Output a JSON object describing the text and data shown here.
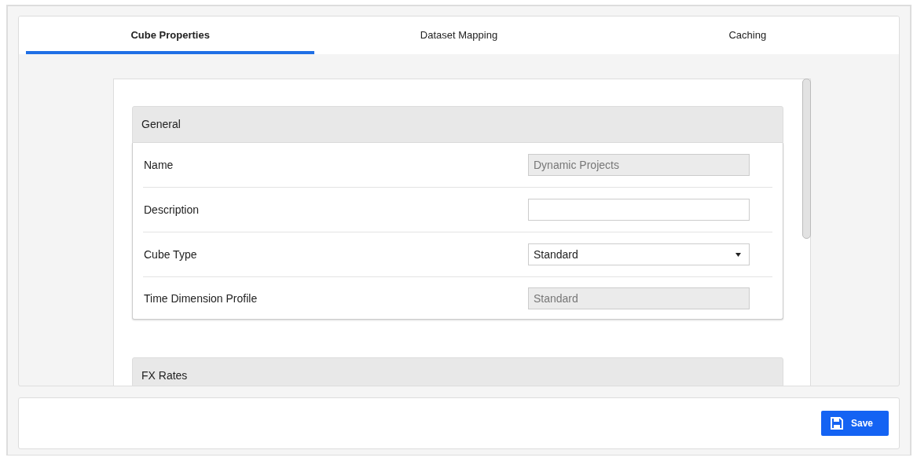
{
  "tabs": [
    {
      "label": "Cube Properties",
      "selected": true
    },
    {
      "label": "Dataset Mapping",
      "selected": false
    },
    {
      "label": "Caching",
      "selected": false
    }
  ],
  "sections": [
    {
      "title": "General",
      "fields": [
        {
          "label": "Name",
          "kind": "text",
          "value": "Dynamic Projects",
          "disabled": true
        },
        {
          "label": "Description",
          "kind": "text",
          "disabled": false
        },
        {
          "label": "Cube Type",
          "kind": "select",
          "value": "Standard",
          "disabled": false
        },
        {
          "label": "Time Dimension Profile",
          "kind": "text",
          "value": "Standard",
          "disabled": true
        }
      ]
    },
    {
      "title": "FX Rates"
    }
  ],
  "save_button": {
    "label": "Save"
  }
}
